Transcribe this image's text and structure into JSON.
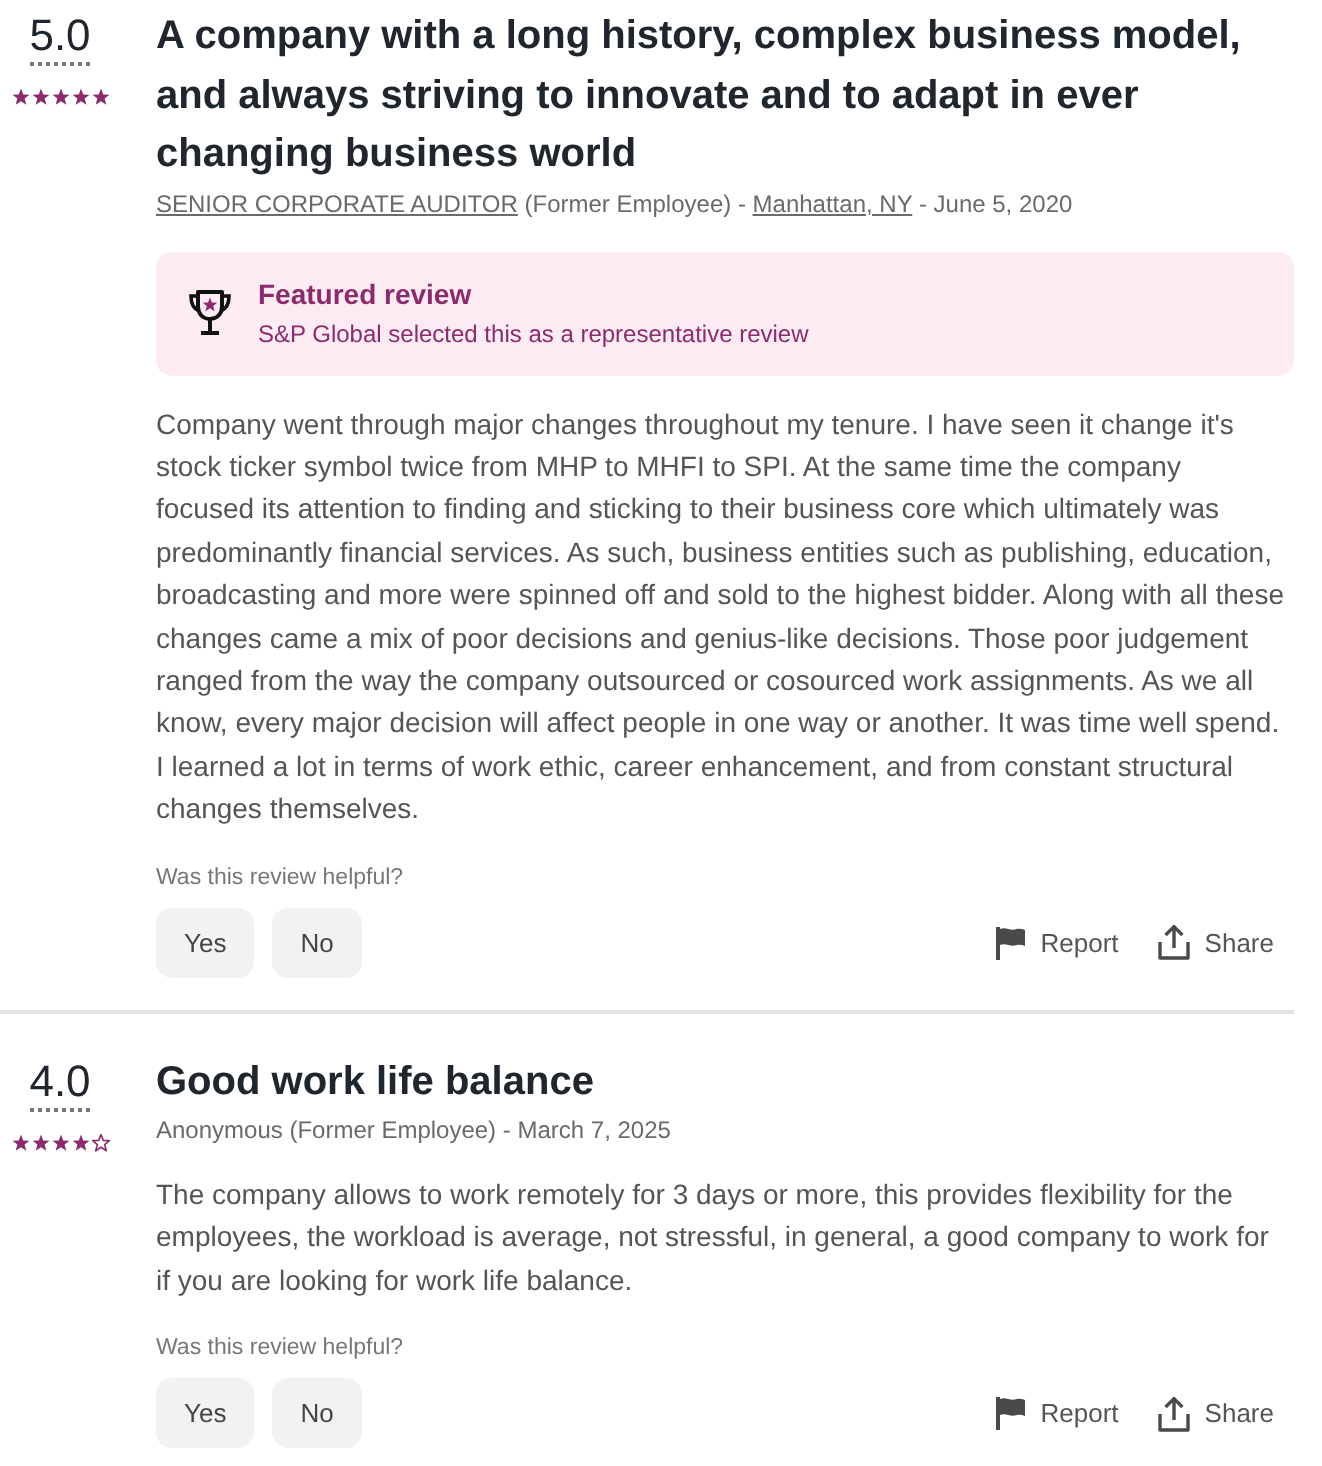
{
  "reviews": [
    {
      "rating": "5.0",
      "stars": 5,
      "title": "A company with a long history, complex business model, and always striving to innovate and to adapt in ever changing business world",
      "meta": [
        {
          "kind": "job_title",
          "text": "SENIOR CORPORATE AUDITOR"
        },
        {
          "kind": "text",
          "text": " (Former Employee) - "
        },
        {
          "kind": "location",
          "text": "Manhattan, NY"
        },
        {
          "kind": "text",
          "text": " - June 5, 2020"
        }
      ],
      "featured": {
        "title": "Featured review",
        "text": "S&P Global selected this as a representative review"
      },
      "body": "Company went through major changes throughout my tenure. I have seen it change it's stock ticker symbol twice from MHP to MHFI to SPI. At the same time the company focused its attention to finding and sticking to their business core which ultimately was predominantly financial services. As such, business entities such as publishing, education, broadcasting and more were spinned off and sold to the highest bidder. Along with all these changes came a mix of poor decisions and genius-like decisions. Those poor judgement ranged from the way the company outsourced or cosourced work assignments. As we all know, every major decision will affect people in one way or another. It was time well spend. I learned a lot in terms of work ethic, career enhancement, and from constant structural changes themselves.",
      "helpful_prompt": "Was this review helpful?",
      "votes": [
        "Yes",
        "No"
      ],
      "actions": [
        {
          "kind": "report",
          "label": "Report"
        },
        {
          "kind": "share",
          "label": "Share"
        }
      ]
    },
    {
      "rating": "4.0",
      "stars": 4,
      "title": "Good work life balance",
      "meta": [
        {
          "kind": "text",
          "text": "Anonymous (Former Employee) - March 7, 2025"
        }
      ],
      "body": "The company allows to work remotely for 3 days or more, this provides flexibility for the employees, the workload is average, not stressful, in general, a good company to work for if you are looking for work life balance.",
      "helpful_prompt": "Was this review helpful?",
      "votes": [
        "Yes",
        "No"
      ],
      "actions": [
        {
          "kind": "report",
          "label": "Report"
        },
        {
          "kind": "share",
          "label": "Share"
        }
      ]
    }
  ]
}
